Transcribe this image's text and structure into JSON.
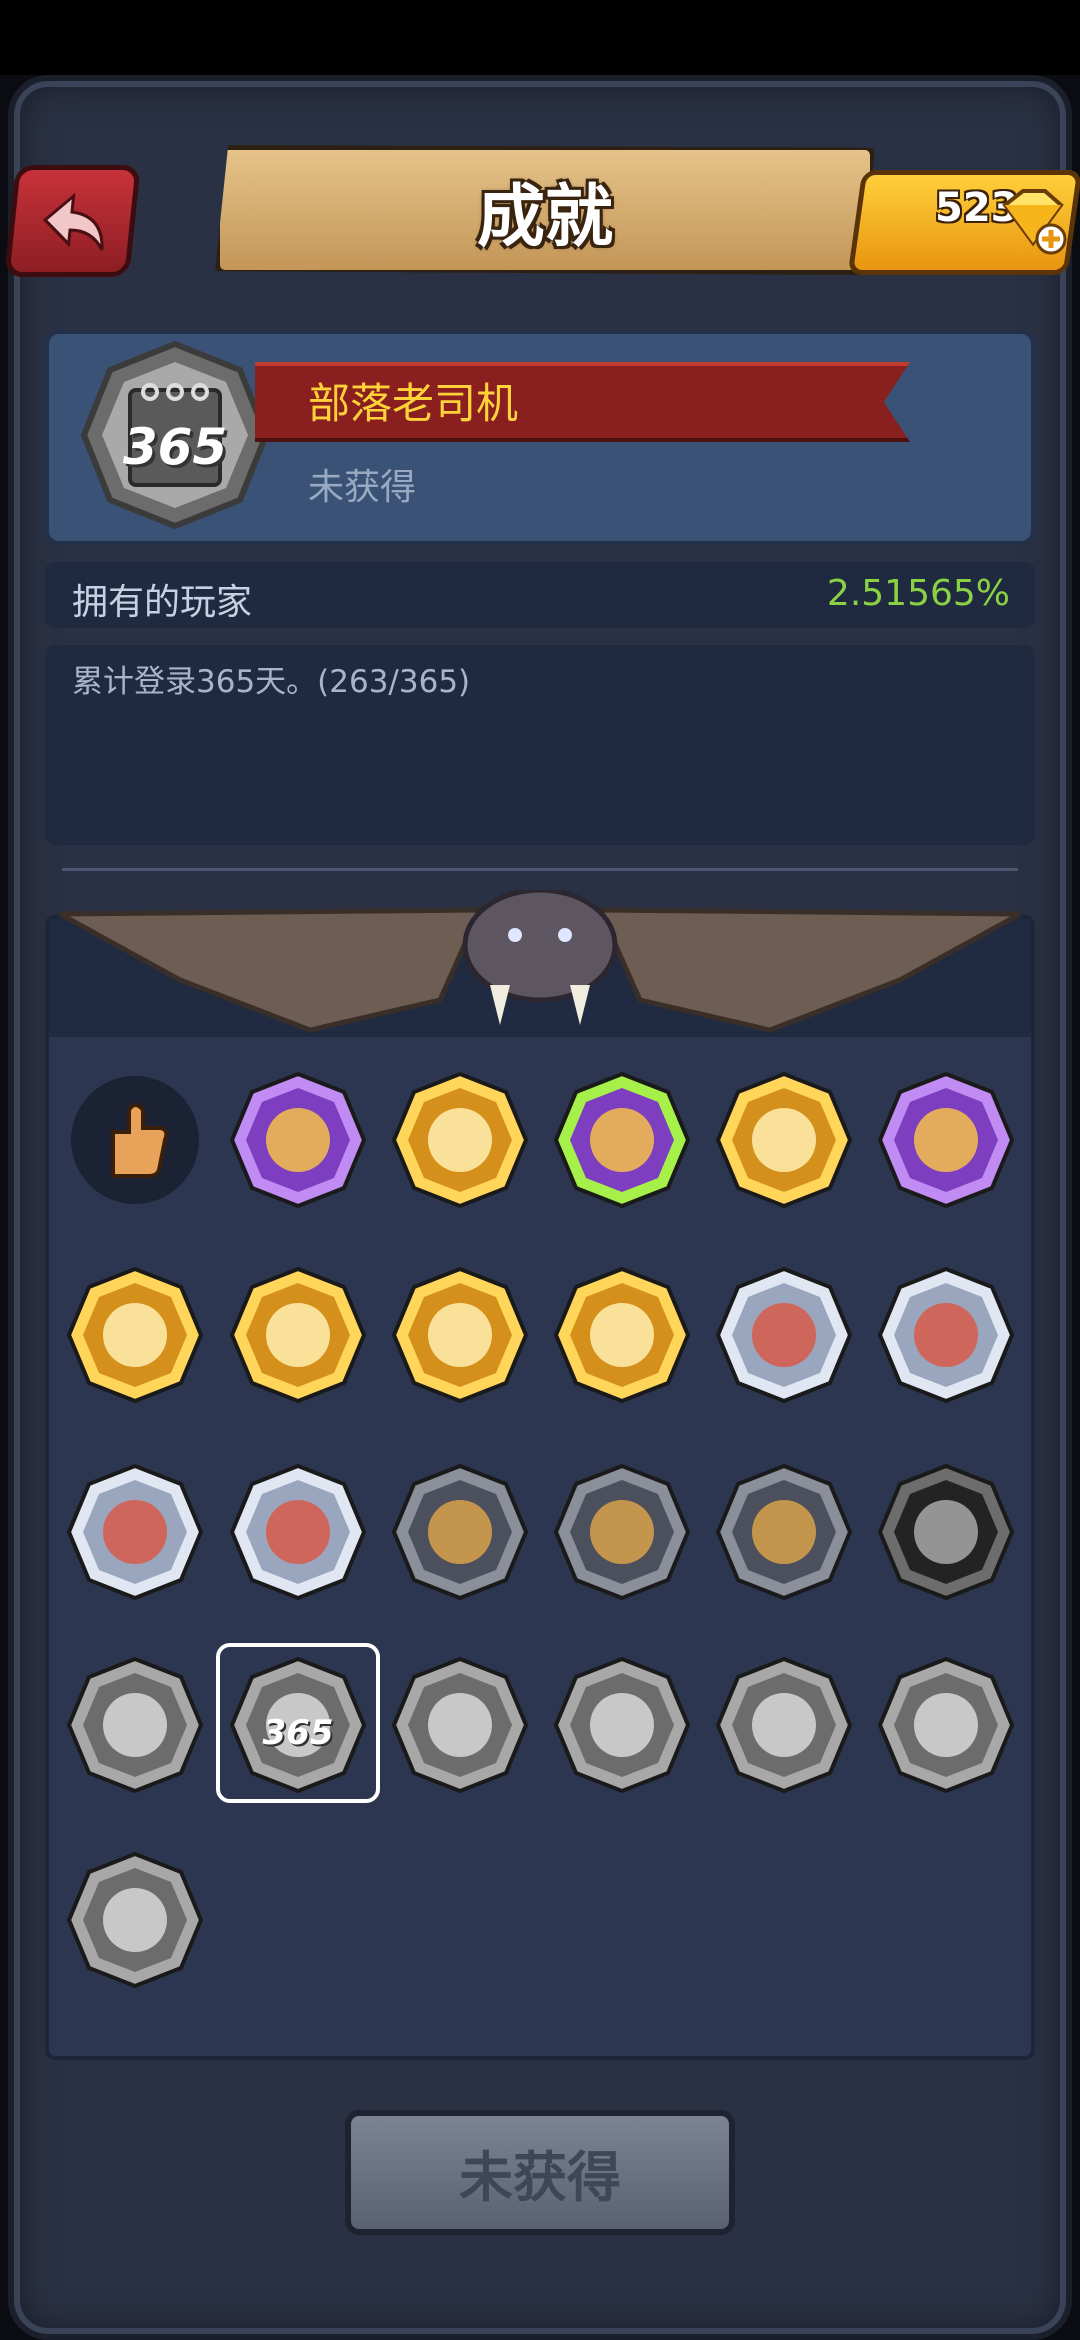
{
  "header": {
    "title": "成就",
    "gem_count": "523",
    "back_icon": "back-arrow-icon",
    "gem_icon": "gem-plus-icon"
  },
  "selected_achievement": {
    "name": "部落老司机",
    "status": "未获得",
    "badge_text": "365",
    "owners_label": "拥有的玩家",
    "owners_value": "2.51565%",
    "description": "累计登录365天。(263/365)"
  },
  "badges": [
    {
      "icon": "thumbs-up-icon",
      "style": "plain"
    },
    {
      "icon": "golden-shield-icon",
      "style": "purple"
    },
    {
      "icon": "gold-pile-icon",
      "style": "gold"
    },
    {
      "icon": "star-wreath-warrior-icon",
      "style": "purple-glow"
    },
    {
      "icon": "creature-face-icon",
      "style": "gold"
    },
    {
      "icon": "tribal-chief-icon",
      "style": "purple"
    },
    {
      "icon": "ice-crystal-icon",
      "style": "gold"
    },
    {
      "icon": "gear-icon",
      "style": "gold"
    },
    {
      "icon": "loot-bag-icon",
      "style": "gold"
    },
    {
      "icon": "shouting-caveman-icon",
      "style": "gold"
    },
    {
      "icon": "purple-orb-bones-icon",
      "style": "silver"
    },
    {
      "icon": "demon-bones-icon",
      "style": "silver"
    },
    {
      "icon": "crossed-bones-icon",
      "style": "silver"
    },
    {
      "icon": "grinning-caveman-icon",
      "style": "silver"
    },
    {
      "icon": "mammoth-icon",
      "style": "dark"
    },
    {
      "icon": "golden-tree-icon",
      "style": "dark"
    },
    {
      "icon": "headband-caveman-icon",
      "style": "dark"
    },
    {
      "icon": "dragon-stars-icon",
      "style": "black"
    },
    {
      "icon": "stone-idol-icon",
      "style": "grey"
    },
    {
      "icon": "calendar-365-icon",
      "style": "grey",
      "label": "365",
      "selected": true
    },
    {
      "icon": "whale-icon",
      "style": "grey"
    },
    {
      "icon": "trophy-icon",
      "style": "grey"
    },
    {
      "icon": "gift-skull-icon",
      "style": "grey"
    },
    {
      "icon": "anvil-hammer-icon",
      "style": "grey"
    },
    {
      "icon": "stone-pot-icon",
      "style": "grey"
    }
  ],
  "footer": {
    "claim_label": "未获得"
  },
  "colors": {
    "accent_gold": "#ffd23a",
    "percent_green": "#8ad243",
    "ribbon_red": "#8a1f1f",
    "panel_blue": "#2c3650"
  }
}
